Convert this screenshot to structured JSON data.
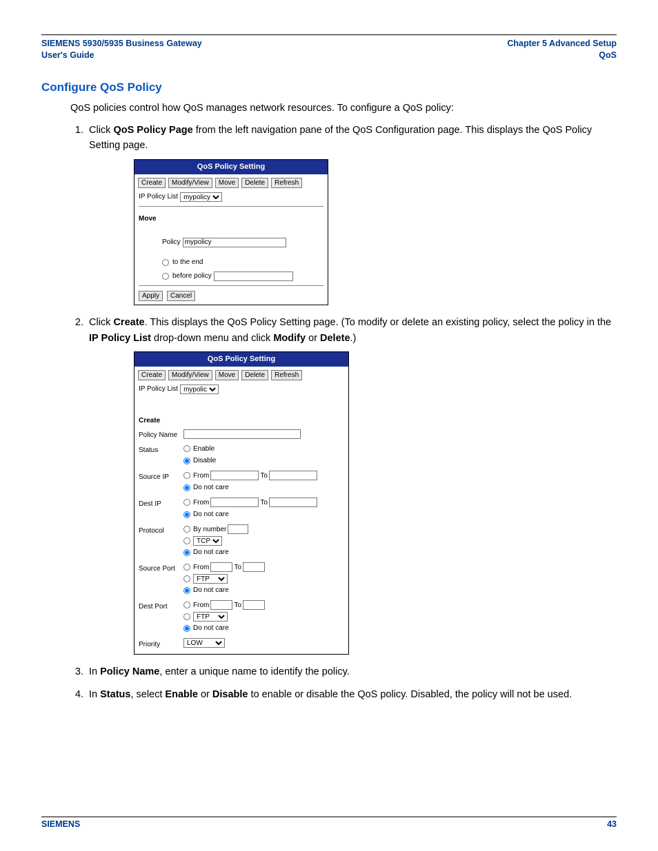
{
  "header": {
    "left_line1": "SIEMENS 5930/5935 Business Gateway",
    "left_line2": "User's Guide",
    "right_line1": "Chapter 5  Advanced Setup",
    "right_line2": "QoS"
  },
  "section_title": "Configure QoS Policy",
  "intro": "QoS policies control how QoS manages network resources. To configure a QoS policy:",
  "step1": {
    "pre": "Click ",
    "bold": "QoS Policy Page",
    "post": " from the left navigation pane of the QoS Configuration page. This displays the QoS Policy Setting page."
  },
  "panel1": {
    "title": "QoS Policy Setting",
    "buttons": {
      "create": "Create",
      "modify": "Modify/View",
      "move": "Move",
      "delete": "Delete",
      "refresh": "Refresh"
    },
    "ip_policy_label": "IP Policy List",
    "ip_policy_value": "mypolicy",
    "move_label": "Move",
    "policy_label": "Policy",
    "policy_value": "mypolicy",
    "opt_to_end": "to the end",
    "opt_before": "before policy",
    "apply": "Apply",
    "cancel": "Cancel"
  },
  "step2": {
    "pre": "Click ",
    "b1": "Create",
    "mid1": ". This displays the QoS Policy Setting page. (To modify or delete an existing policy, select the policy in the ",
    "b2": "IP Policy List",
    "mid2": " drop-down menu and click ",
    "b3": "Modify",
    "mid3": " or ",
    "b4": "Delete",
    "post": ".)"
  },
  "panel2": {
    "title": "QoS Policy Setting",
    "buttons": {
      "create": "Create",
      "modify": "Modify/View",
      "move": "Move",
      "delete": "Delete",
      "refresh": "Refresh"
    },
    "ip_policy_label": "IP Policy List",
    "ip_policy_value": "mypolic",
    "create_label": "Create",
    "fields": {
      "policy_name": "Policy Name",
      "status": "Status",
      "status_enable": "Enable",
      "status_disable": "Disable",
      "source_ip": "Source IP",
      "dest_ip": "Dest IP",
      "from": "From",
      "to": "To",
      "dnc": "Do not care",
      "protocol": "Protocol",
      "by_number": "By number",
      "tcp": "TCP",
      "source_port": "Source Port",
      "dest_port": "Dest Port",
      "ftp": "FTP",
      "priority": "Priority",
      "priority_value": "LOW"
    }
  },
  "step3": {
    "pre": "In ",
    "b1": "Policy Name",
    "post": ", enter a unique name to identify the policy."
  },
  "step4": {
    "pre": "In ",
    "b1": "Status",
    "mid1": ", select ",
    "b2": "Enable",
    "mid2": " or ",
    "b3": "Disable",
    "post": " to enable or disable the QoS policy. Disabled, the policy will not be used."
  },
  "footer": {
    "left": "SIEMENS",
    "right": "43"
  }
}
